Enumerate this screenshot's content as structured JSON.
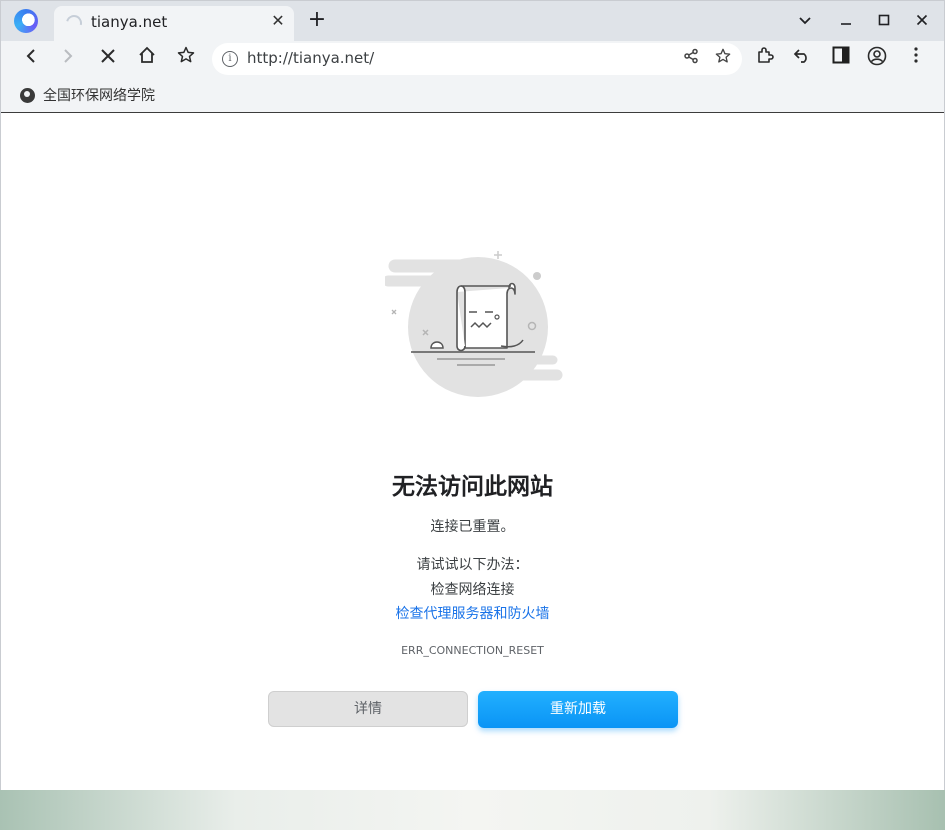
{
  "tab": {
    "title": "tianya.net"
  },
  "toolbar": {
    "url": "http://tianya.net/"
  },
  "bookmarks": [
    {
      "label": "全国环保网络学院"
    }
  ],
  "error": {
    "title": "无法访问此网站",
    "subtitle": "连接已重置。",
    "try_label": "请试试以下办法：",
    "suggestion": "检查网络连接",
    "link": "检查代理服务器和防火墙",
    "code": "ERR_CONNECTION_RESET",
    "details_button": "详情",
    "reload_button": "重新加载"
  },
  "colors": {
    "accent": "#1a73e8",
    "reload_button": "#0a94f5"
  }
}
